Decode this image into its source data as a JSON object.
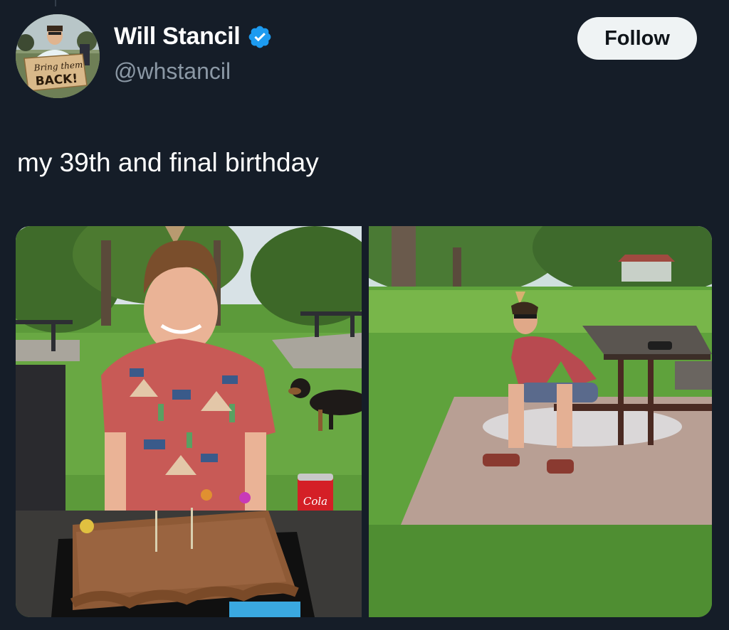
{
  "author": {
    "name": "Will Stancil",
    "handle": "@whstancil",
    "verified": true,
    "avatar_sign_text": "Bring them BACK!"
  },
  "follow_button": {
    "label": "Follow"
  },
  "tweet": {
    "text": "my 39th and final birthday"
  },
  "media": {
    "count": 2,
    "photos": [
      {
        "subject": "person-with-birthday-cake-and-cola-can",
        "can_label": "Cola"
      },
      {
        "subject": "person-sitting-at-picnic-table"
      }
    ]
  },
  "colors": {
    "background": "#151d28",
    "verified_badge": "#1d9bf0",
    "follow_bg": "#eff3f4",
    "handle": "#8b98a5"
  },
  "icons": [
    "verified-badge-icon"
  ]
}
